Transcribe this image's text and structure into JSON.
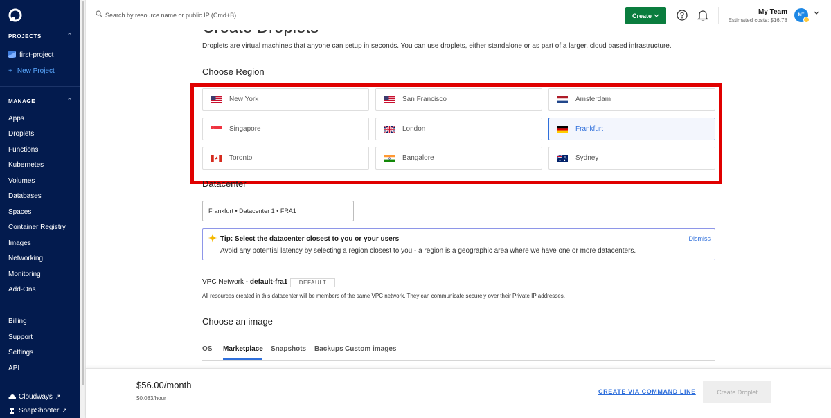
{
  "sidebar": {
    "projects_heading": "PROJECTS",
    "project_name": "first-project",
    "new_project": "New Project",
    "manage_heading": "MANAGE",
    "manage_items": [
      "Apps",
      "Droplets",
      "Functions",
      "Kubernetes",
      "Volumes",
      "Databases",
      "Spaces",
      "Container Registry",
      "Images",
      "Networking",
      "Monitoring",
      "Add-Ons"
    ],
    "account_items": [
      "Billing",
      "Support",
      "Settings",
      "API"
    ],
    "bottom_links": [
      "Cloudways",
      "SnapShooter"
    ]
  },
  "topbar": {
    "search_placeholder": "Search by resource name or public IP (Cmd+B)",
    "create_label": "Create",
    "team_name": "My Team",
    "estimated_cost": "Estimated costs: $16.78",
    "avatar_initials": "MT"
  },
  "main": {
    "title": "Create Droplets",
    "intro": "Droplets are virtual machines that anyone can setup in seconds. You can use droplets, either standalone or as part of a larger, cloud based infrastructure.",
    "region_heading": "Choose Region",
    "regions": [
      {
        "name": "New York",
        "flag": "us-flag"
      },
      {
        "name": "San Francisco",
        "flag": "us-flag"
      },
      {
        "name": "Amsterdam",
        "flag": "nl-flag"
      },
      {
        "name": "Singapore",
        "flag": "sg-flag"
      },
      {
        "name": "London",
        "flag": "uk-flag"
      },
      {
        "name": "Frankfurt",
        "flag": "de-flag",
        "selected": true
      },
      {
        "name": "Toronto",
        "flag": "ca-flag"
      },
      {
        "name": "Bangalore",
        "flag": "in-flag"
      },
      {
        "name": "Sydney",
        "flag": "au-flag"
      }
    ],
    "datacenter_heading": "Datacenter",
    "datacenter_value": "Frankfurt • Datacenter 1 • FRA1",
    "tip_title": "Tip: Select the datacenter closest to you or your users",
    "tip_body": "Avoid any potential latency by selecting a region closest to you - a region is a geographic area where we have one or more datacenters.",
    "tip_dismiss": "Dismiss",
    "vpc_prefix": "VPC Network - ",
    "vpc_name": "default-fra1",
    "vpc_badge": "DEFAULT",
    "vpc_note": "All resources created in this datacenter will be members of the same VPC network. They can communicate securely over their Private IP addresses.",
    "image_heading": "Choose an image",
    "image_tabs": [
      "OS",
      "Marketplace",
      "Snapshots",
      "Backups",
      "Custom images"
    ],
    "active_image_tab": "Marketplace"
  },
  "footer": {
    "price": "$56.00/month",
    "price_hour": "$0.083/hour",
    "cli_link": "CREATE VIA COMMAND LINE",
    "create_button": "Create Droplet"
  },
  "colors": {
    "sidebar_bg": "#031b4e",
    "accent": "#2f6fdb",
    "create_green": "#0a7d3e",
    "highlight_red": "#e00000"
  }
}
